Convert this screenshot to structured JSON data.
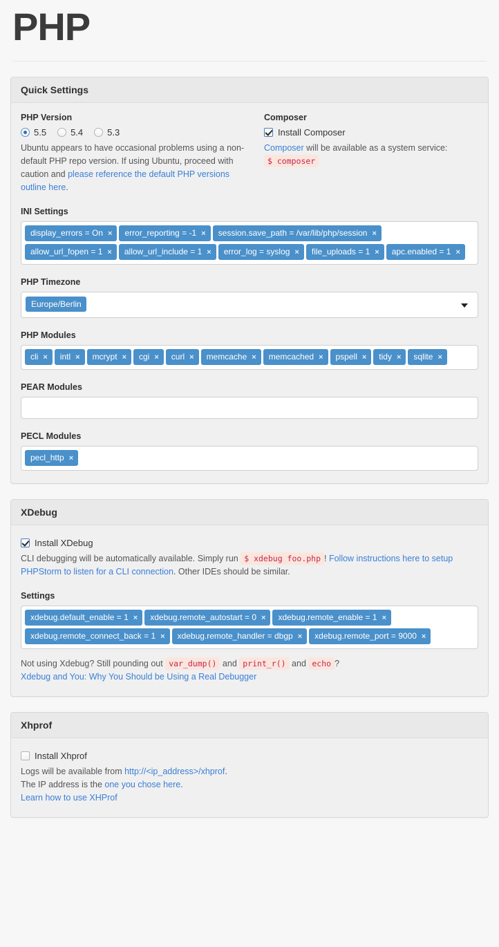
{
  "page": {
    "title": "PHP"
  },
  "panels": {
    "quick": {
      "header": "Quick Settings",
      "php_version": {
        "label": "PHP Version",
        "options": [
          "5.5",
          "5.4",
          "5.3"
        ],
        "selected": "5.5",
        "help_before": "Ubuntu appears to have occasional problems using a non-default PHP repo version. If using Ubuntu, proceed with caution and ",
        "help_link": "please reference the default PHP versions outline here",
        "help_after": "."
      },
      "composer": {
        "label": "Composer",
        "checkbox_label": "Install Composer",
        "checked": true,
        "note_link": "Composer",
        "note_text": " will be available as a system service:",
        "code": "$ composer"
      },
      "ini": {
        "label": "INI Settings",
        "tags": [
          "display_errors = On",
          "error_reporting = -1",
          "session.save_path = /var/lib/php/session",
          "allow_url_fopen = 1",
          "allow_url_include = 1",
          "error_log = syslog",
          "file_uploads = 1",
          "apc.enabled = 1"
        ]
      },
      "timezone": {
        "label": "PHP Timezone",
        "selected": "Europe/Berlin"
      },
      "php_modules": {
        "label": "PHP Modules",
        "tags": [
          "cli",
          "intl",
          "mcrypt",
          "cgi",
          "curl",
          "memcache",
          "memcached",
          "pspell",
          "tidy",
          "sqlite"
        ]
      },
      "pear_modules": {
        "label": "PEAR Modules",
        "tags": []
      },
      "pecl_modules": {
        "label": "PECL Modules",
        "tags": [
          "pecl_http"
        ]
      }
    },
    "xdebug": {
      "header": "XDebug",
      "checkbox_label": "Install XDebug",
      "checked": true,
      "help_1": "CLI debugging will be automatically available. Simply run ",
      "help_code": "$ xdebug foo.php",
      "help_2": "! ",
      "help_link": "Follow instructions here to setup PHPStorm to listen for a CLI connection",
      "help_3": ". Other IDEs should be similar.",
      "settings_label": "Settings",
      "tags": [
        "xdebug.default_enable = 1",
        "xdebug.remote_autostart = 0",
        "xdebug.remote_enable = 1",
        "xdebug.remote_connect_back = 1",
        "xdebug.remote_handler = dbgp",
        "xdebug.remote_port = 9000"
      ],
      "footer_1": "Not using Xdebug? Still pounding out ",
      "footer_code_1": "var_dump()",
      "footer_2": " and ",
      "footer_code_2": "print_r()",
      "footer_3": " and ",
      "footer_code_3": "echo",
      "footer_4": "?",
      "footer_link": "Xdebug and You: Why You Should be Using a Real Debugger"
    },
    "xhprof": {
      "header": "Xhprof",
      "checkbox_label": "Install Xhprof",
      "checked": false,
      "line1_before": "Logs will be available from ",
      "line1_link": "http://<ip_address>/xhprof",
      "line1_after": ".",
      "line2_before": "The IP address is the ",
      "line2_link": "one you chose here",
      "line2_after": ".",
      "line3_link": "Learn how to use XHProf"
    }
  },
  "colors": {
    "tag_blue": "#4a90ca",
    "link_blue": "#3a7fd5",
    "code_red": "#c7254e",
    "code_bg": "#fae6dd"
  }
}
